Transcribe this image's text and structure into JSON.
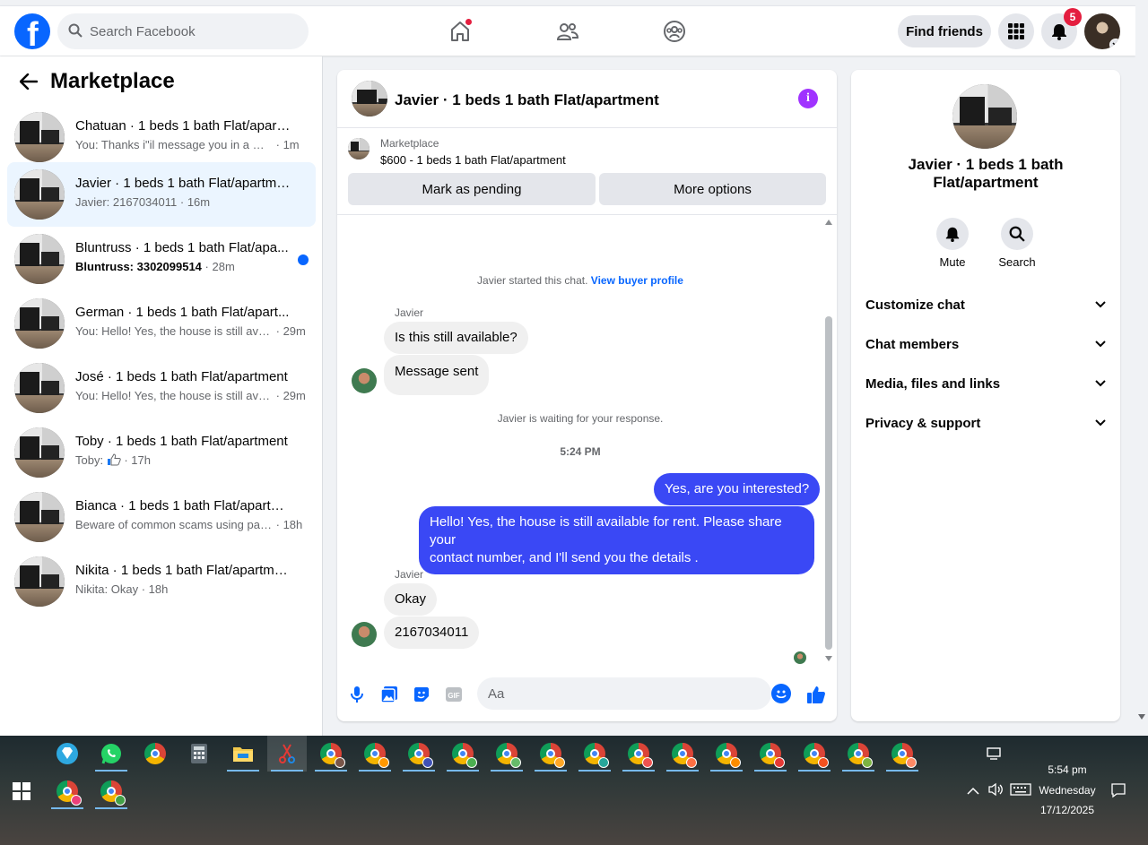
{
  "navbar": {
    "search_placeholder": "Search Facebook",
    "find_friends_label": "Find friends",
    "notification_count": "5"
  },
  "left_panel": {
    "title": "Marketplace",
    "conversations": [
      {
        "title": "Chatuan · 1 beds 1 bath Flat/apart...",
        "snippet": "You: Thanks i\"il message you in a mo...",
        "time": "· 1m"
      },
      {
        "title": "Javier · 1 beds 1 bath Flat/apartment",
        "snippet": "Javier: 2167034011",
        "time": "· 16m"
      },
      {
        "title": "Bluntruss · 1 beds 1 bath Flat/apa...",
        "snippet": "Bluntruss: 3302099514",
        "time": "· 28m"
      },
      {
        "title": "German · 1 beds 1 bath Flat/apart...",
        "snippet": "You: Hello! Yes, the house is still avai...",
        "time": "· 29m"
      },
      {
        "title": "José · 1 beds 1 bath Flat/apartment",
        "snippet": "You: Hello! Yes, the house is still avai...",
        "time": "· 29m"
      },
      {
        "title": "Toby · 1 beds 1 bath Flat/apartment",
        "snippet": "Toby:",
        "time": "· 17h"
      },
      {
        "title": "Bianca · 1 beds 1 bath Flat/apartm...",
        "snippet": "Beware of common scams using pay...",
        "time": "· 18h"
      },
      {
        "title": "Nikita · 1 beds 1 bath Flat/apartment",
        "snippet": "Nikita: Okay",
        "time": "· 18h"
      }
    ]
  },
  "chat": {
    "header_title": "Javier · 1 beds 1 bath Flat/apartment",
    "marketplace_label": "Marketplace",
    "listing": "$600 - 1 beds 1 bath Flat/apartment",
    "mark_pending_label": "Mark as pending",
    "more_options_label": "More options",
    "started_text": "Javier started this chat.",
    "view_profile_link": "View buyer profile",
    "sender_name": "Javier",
    "msg_1": "Is this still available?",
    "msg_2": "Message sent",
    "waiting_text": "Javier is waiting for your response.",
    "timestamp": "5:24 PM",
    "out_1": "Yes, are you interested?",
    "out_2_line1": "Hello! Yes, the house is still available for rent. Please share your",
    "out_2_line2": "contact number, and I'll send you the details .",
    "msg_3": "Okay",
    "msg_4": "2167034011",
    "composer_placeholder": "Aa"
  },
  "right_panel": {
    "name_line1": "Javier · 1 beds 1 bath",
    "name_line2": "Flat/apartment",
    "mute_label": "Mute",
    "search_label": "Search",
    "rows": [
      "Customize chat",
      "Chat members",
      "Media, files and links",
      "Privacy & support"
    ]
  },
  "taskbar": {
    "time": "5:54 pm",
    "day": "Wednesday",
    "date": "17/12/2025"
  },
  "colors": {
    "brand": "#0866ff",
    "outgoing_bubble": "#3a48f5",
    "active_conversation": "#ebf5ff",
    "notification_badge": "#e41e3f",
    "info_icon": "#a033ff"
  }
}
